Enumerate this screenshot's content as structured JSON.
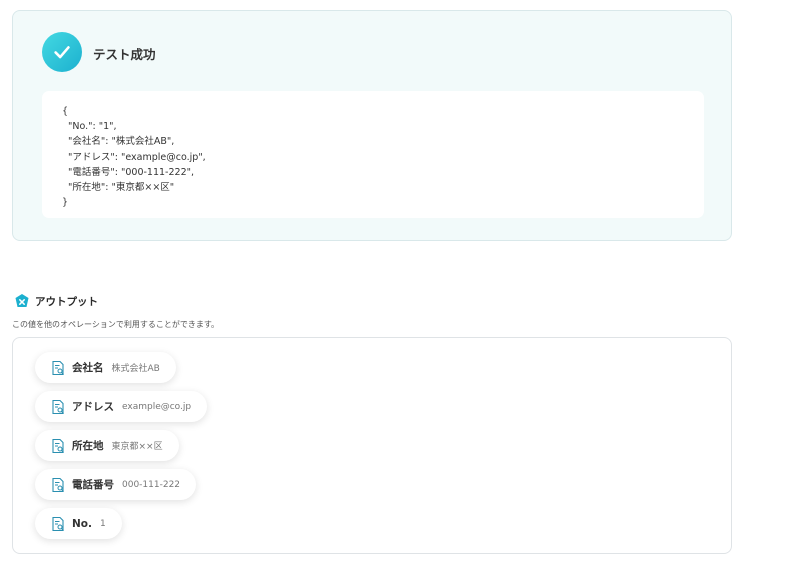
{
  "test_result": {
    "title": "テスト成功",
    "json_lines": [
      "{",
      "  \"No.\": \"1\",",
      "  \"会社名\": \"株式会社AB\",",
      "  \"アドレス\": \"example@co.jp\",",
      "  \"電話番号\": \"000-111-222\",",
      "  \"所在地\": \"東京都××区\"",
      "}"
    ]
  },
  "output": {
    "title": "アウトプット",
    "description": "この値を他のオペレーションで利用することができます。",
    "items": [
      {
        "label": "会社名",
        "value": "株式会社AB"
      },
      {
        "label": "アドレス",
        "value": "example@co.jp"
      },
      {
        "label": "所在地",
        "value": "東京都××区"
      },
      {
        "label": "電話番号",
        "value": "000-111-222"
      },
      {
        "label": "No.",
        "value": "1"
      }
    ]
  },
  "colors": {
    "accent": "#1cb0cf",
    "panel_bg": "#f2fafa"
  },
  "icons": {
    "success": "check-icon",
    "output": "output-badge-icon",
    "item": "document-search-icon"
  }
}
